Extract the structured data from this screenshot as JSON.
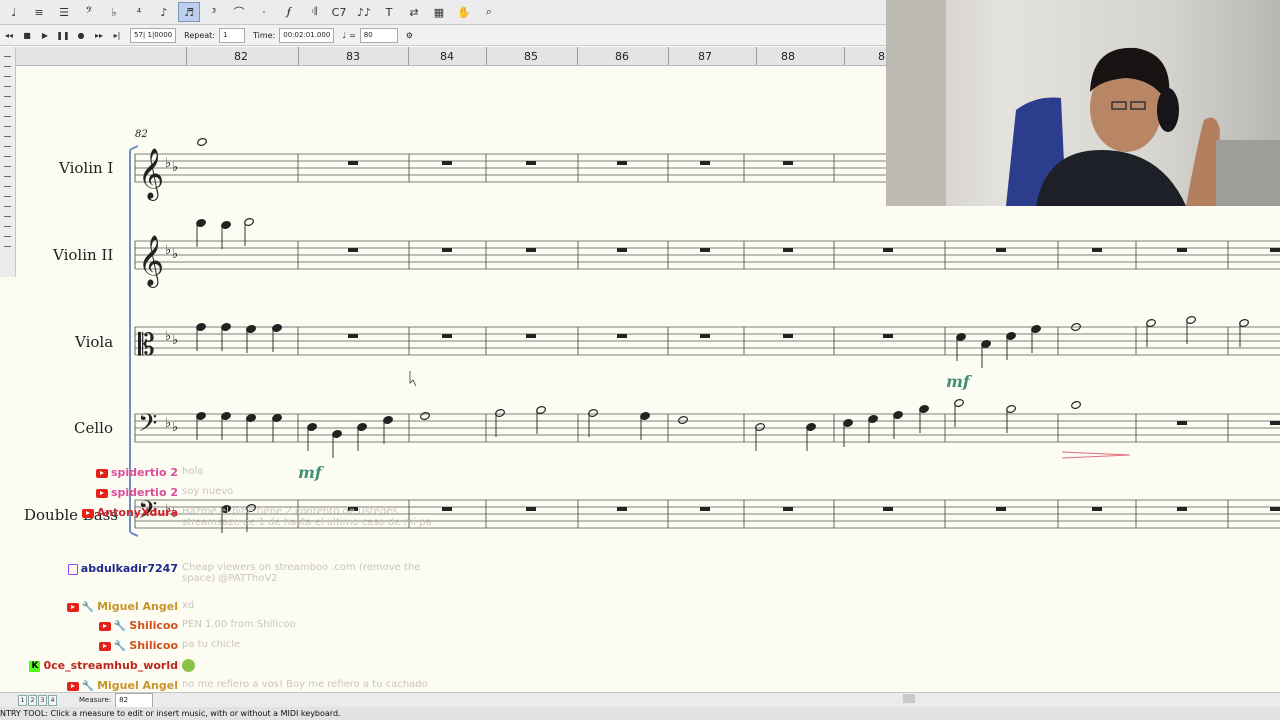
{
  "toolbar": {
    "tools": [
      "tempo-icon",
      "staff-icon",
      "staff-list-icon",
      "clef-icon",
      "key-signature-icon",
      "time-signature-icon",
      "simple-entry-icon",
      "speedy-entry-icon",
      "tuplet-icon",
      "smart-shape-icon",
      "articulation-icon",
      "expression-icon",
      "repeat-icon",
      "chord-icon",
      "lyrics-icon",
      "text-icon",
      "mirror-icon",
      "graphics-icon",
      "hand-grabber-icon",
      "zoom-icon"
    ],
    "active_index": 7
  },
  "transport": {
    "position_value": "57| 1|0000",
    "repeat_label": "Repeat:",
    "repeat_value": "1",
    "time_label": "Time:",
    "time_value": "00:02:01.000",
    "tempo_equals": "=",
    "tempo_value": "80"
  },
  "ruler": {
    "measures": [
      "82",
      "83",
      "84",
      "85",
      "86",
      "87",
      "88",
      "8"
    ]
  },
  "score": {
    "start_measure_label": "82",
    "instruments": [
      "Violin I",
      "Violin II",
      "Viola",
      "Cello",
      "Double Bass"
    ],
    "dynamic_mf": "mf"
  },
  "chat": [
    {
      "platform": "youtube",
      "mod": false,
      "user": "spidertio 2",
      "color": "#d94d9b",
      "message": "hola"
    },
    {
      "platform": "youtube",
      "mod": false,
      "user": "spidertio 2",
      "color": "#d94d9b",
      "message": "soy nuevo"
    },
    {
      "platform": "youtube",
      "mod": false,
      "user": "AntonyXdura",
      "color": "#d0222a",
      "message": "Hazme el pibe tiene 2 contento de ustedes streamsazo de 1 de hasta el ultimo caso de mi pa"
    },
    {
      "platform": "twitch",
      "mod": false,
      "user": "abdulkadir7247",
      "color": "#1b2c8c",
      "message": "Cheap viewers on streamboo .com (remove the space) @PATThoV2"
    },
    {
      "platform": "youtube",
      "mod": true,
      "user": "Miguel Angel",
      "color": "#c8952a",
      "message": "xd"
    },
    {
      "platform": "youtube",
      "mod": true,
      "user": "Shilicoo",
      "color": "#d0501c",
      "message": "PEN 1.00 from Shilicoo"
    },
    {
      "platform": "youtube",
      "mod": true,
      "user": "Shilicoo",
      "color": "#d0501c",
      "message": "pa tu chicle"
    },
    {
      "platform": "kick",
      "mod": false,
      "user": "0ce_streamhub_world",
      "color": "#c0251b",
      "message": ""
    },
    {
      "platform": "youtube",
      "mod": true,
      "user": "Miguel Angel",
      "color": "#c8952a",
      "message": "no me refiero a vos! Boy me refiero a tu cachado"
    }
  ],
  "bottombar": {
    "pages": [
      "1",
      "2",
      "3",
      "4"
    ],
    "measure_label": "Measure:",
    "measure_value": "82"
  },
  "status": "NTRY TOOL: Click a measure to edit or insert music, with or without a MIDI keyboard."
}
